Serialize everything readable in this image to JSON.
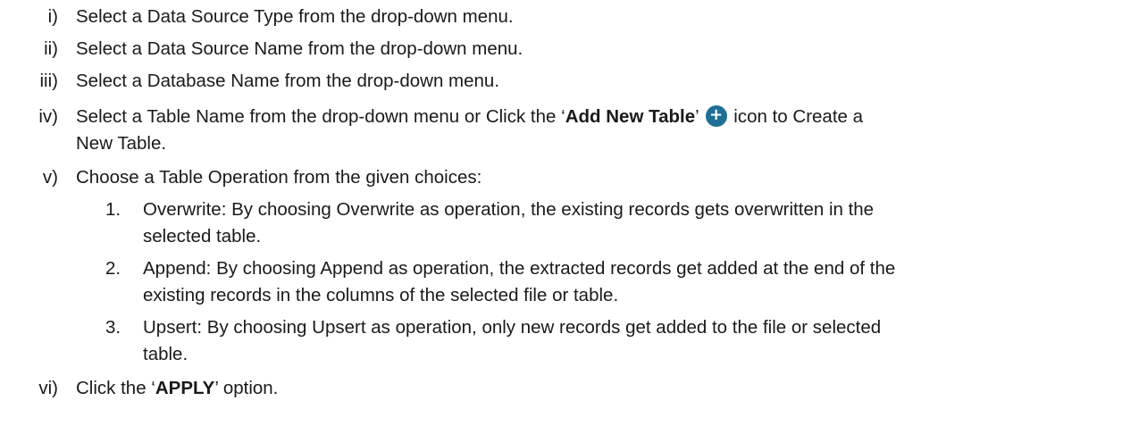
{
  "steps": [
    {
      "numeral": "i)",
      "text": "Select a Data Source Type from the drop-down menu."
    },
    {
      "numeral": "ii)",
      "text": "Select a Data Source Name from the drop-down menu."
    },
    {
      "numeral": "iii)",
      "text": "Select a Database Name from the drop-down menu."
    },
    {
      "numeral": "iv)",
      "text_before": "Select a Table Name from the drop-down menu or Click the ‘",
      "bold": "Add New Table",
      "text_mid": "’ ",
      "icon_name": "add-circle-icon",
      "icon_glyph": "+",
      "icon_color": "#1f6f95",
      "text_after_line1": " icon to Create a",
      "text_after_line2": "New Table."
    },
    {
      "numeral": "v)",
      "text": "Choose a Table Operation from the given choices:"
    },
    {
      "numeral": "vi)",
      "text_before": "Click the ‘",
      "bold": "APPLY",
      "text_after": "’ option."
    }
  ],
  "operations": [
    {
      "number": "1.",
      "line1": "Overwrite: By choosing Overwrite as operation, the existing records gets overwritten in the",
      "line2": "selected table."
    },
    {
      "number": "2.",
      "line1": "Append: By choosing Append as operation, the extracted records get added at the end of the",
      "line2": "existing records in the columns of the selected file or table."
    },
    {
      "number": "3.",
      "line1": "Upsert: By choosing Upsert as operation, only new records get added to the file or selected",
      "line2": "table."
    }
  ]
}
